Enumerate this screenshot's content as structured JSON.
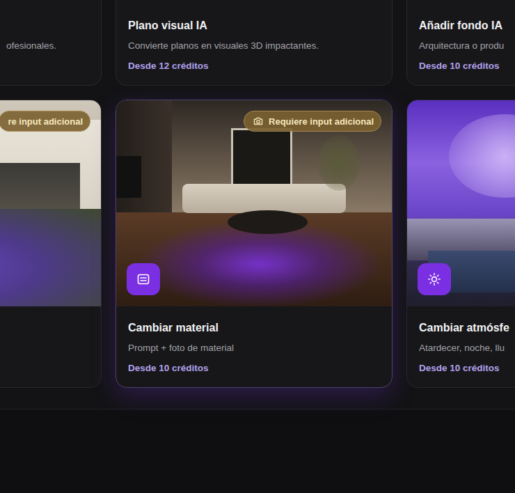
{
  "cards_rows": [
    {
      "cards": [
        {
          "description": "ofesionales.",
          "cut_left": true,
          "hovered": false,
          "has_image": false
        },
        {
          "title": "Plano visual IA",
          "description": "Convierte planos en visuales 3D impactantes.",
          "credits": "Desde 12 créditos",
          "cut_left": false,
          "hovered": false,
          "has_image": false
        },
        {
          "title": "Añadir fondo IA",
          "description": "Arquitectura o produ",
          "credits": "Desde 10 créditos",
          "cut_left": false,
          "hovered": false,
          "has_image": false
        }
      ]
    },
    {
      "cards": [
        {
          "badge": "re input adicional",
          "badge_icon": false,
          "cut_left": true,
          "hovered": false,
          "has_image": true
        },
        {
          "badge": "Requiere input adicional",
          "badge_icon": true,
          "kind": "material",
          "title": "Cambiar material",
          "description": "Prompt + foto de material",
          "credits": "Desde 10 créditos",
          "cut_left": false,
          "hovered": true,
          "has_image": true
        },
        {
          "kind": "atmosphere",
          "title": "Cambiar atmósfe",
          "description": "Atardecer, noche, llu",
          "credits": "Desde 10 créditos",
          "cut_left": false,
          "hovered": false,
          "has_image": true
        }
      ]
    }
  ]
}
